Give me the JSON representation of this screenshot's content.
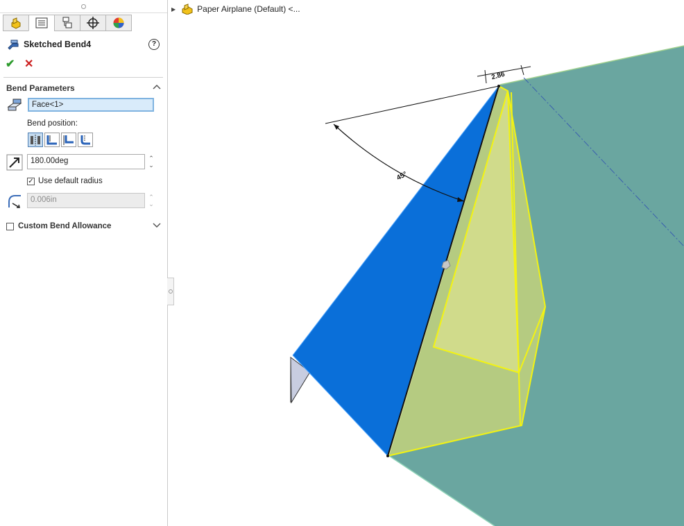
{
  "property_manager": {
    "title": "Sketched Bend4",
    "help": "?",
    "ok_glyph": "✔",
    "cancel_glyph": "✕",
    "tabs": [
      "feature-manager",
      "property-manager",
      "configuration-manager",
      "dimxpert-manager",
      "display-manager"
    ],
    "bend_parameters": {
      "title": "Bend Parameters",
      "face_selection": "Face<1>",
      "bend_position_label": "Bend position:",
      "bend_positions": [
        "bend-centerline",
        "material-inside",
        "material-outside",
        "bend-outside"
      ],
      "selected_position_index": 0,
      "angle_value": "180.00deg",
      "use_default_radius_label": "Use default radius",
      "use_default_radius_checked": true,
      "radius_value": "0.006in"
    },
    "custom_bend_allowance": {
      "label": "Custom Bend Allowance",
      "checked": false
    }
  },
  "viewport": {
    "tree_label": "Paper Airplane (Default) <...",
    "dimension_angle": "45°",
    "dimension_length": "2.86",
    "colors": {
      "selected_face": "#0a6fd9",
      "sheet": "#6aa6a0",
      "preview_fill": "#d6dc74",
      "preview_edge": "#f3f312"
    }
  }
}
